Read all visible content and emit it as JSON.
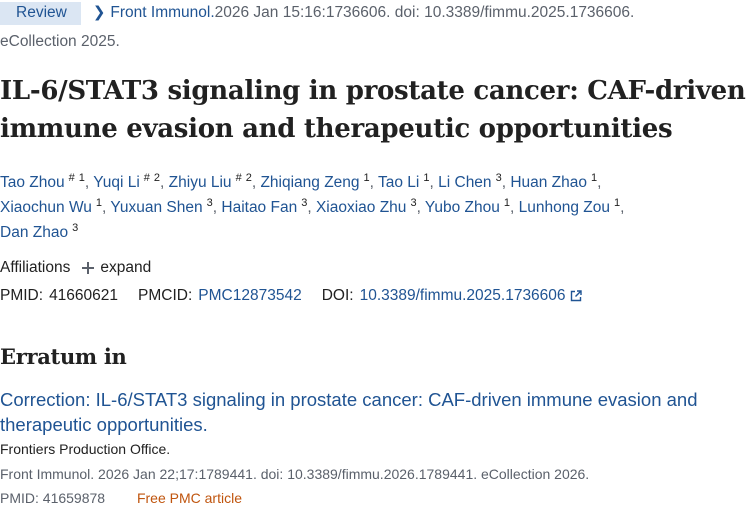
{
  "header": {
    "badge": "Review",
    "journal": "Front Immunol.",
    "citation": " 2026 Jan 15:16:1736606. doi: 10.3389/fimmu.2025.1736606.",
    "citation_line2": "eCollection 2025."
  },
  "article": {
    "title": "IL-6/STAT3 signaling in prostate cancer: CAF-driven immune evasion and therapeutic opportunities"
  },
  "authors": [
    {
      "name": "Tao Zhou",
      "mark": "#",
      "aff": "1"
    },
    {
      "name": "Yuqi Li",
      "mark": "#",
      "aff": "2"
    },
    {
      "name": "Zhiyu Liu",
      "mark": "#",
      "aff": "2"
    },
    {
      "name": "Zhiqiang Zeng",
      "mark": "",
      "aff": "1"
    },
    {
      "name": "Tao Li",
      "mark": "",
      "aff": "1"
    },
    {
      "name": "Li Chen",
      "mark": "",
      "aff": "3"
    },
    {
      "name": "Huan Zhao",
      "mark": "",
      "aff": "1"
    },
    {
      "name": "Xiaochun Wu",
      "mark": "",
      "aff": "1"
    },
    {
      "name": "Yuxuan Shen",
      "mark": "",
      "aff": "3"
    },
    {
      "name": "Haitao Fan",
      "mark": "",
      "aff": "3"
    },
    {
      "name": "Xiaoxiao Zhu",
      "mark": "",
      "aff": "3"
    },
    {
      "name": "Yubo Zhou",
      "mark": "",
      "aff": "1"
    },
    {
      "name": "Lunhong Zou",
      "mark": "",
      "aff": "1"
    },
    {
      "name": "Dan Zhao",
      "mark": "",
      "aff": "3"
    }
  ],
  "affiliations": {
    "label": "Affiliations",
    "expand_label": "expand",
    "expand_icon": "plus-icon"
  },
  "ids": {
    "pmid_label": "PMID:",
    "pmid": "41660621",
    "pmcid_label": "PMCID:",
    "pmcid": "PMC12873542",
    "doi_label": "DOI:",
    "doi": "10.3389/fimmu.2025.1736606",
    "doi_icon": "external-link-icon"
  },
  "erratum": {
    "heading": "Erratum in",
    "title": "Correction: IL-6/STAT3 signaling in prostate cancer: CAF-driven immune evasion and therapeutic opportunities.",
    "authors": "Frontiers Production Office.",
    "citation": "Front Immunol. 2026 Jan 22;17:1789441. doi: 10.3389/fimmu.2026.1789441. eCollection 2026.",
    "pmid_text": "PMID: 41659878",
    "free_label": "Free PMC article"
  },
  "colors": {
    "link": "#205493",
    "badge_bg": "#dbe6f3",
    "muted": "#5b616b",
    "free_pmc": "#c0550e"
  }
}
